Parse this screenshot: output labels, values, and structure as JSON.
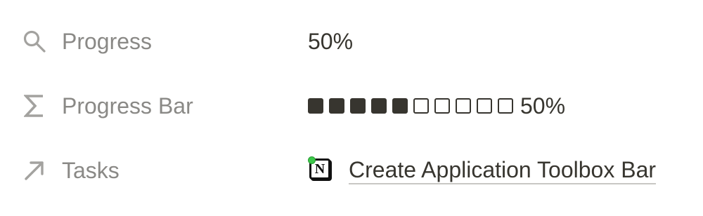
{
  "properties": [
    {
      "name": "Progress",
      "icon": "search-icon",
      "value": "50%"
    },
    {
      "name": "Progress Bar",
      "icon": "sigma-icon",
      "bar": {
        "filled": 5,
        "total": 10,
        "fraction": 0.5
      },
      "value": "50%"
    },
    {
      "name": "Tasks",
      "icon": "arrow-up-right-icon",
      "page_icon": "notion-logo-icon",
      "link_text": "Create Application Toolbox Bar"
    }
  ],
  "colors": {
    "label": "#8a8986",
    "text": "#37352f",
    "icon": "#9b9a97",
    "status_dot": "#3cc84a"
  }
}
